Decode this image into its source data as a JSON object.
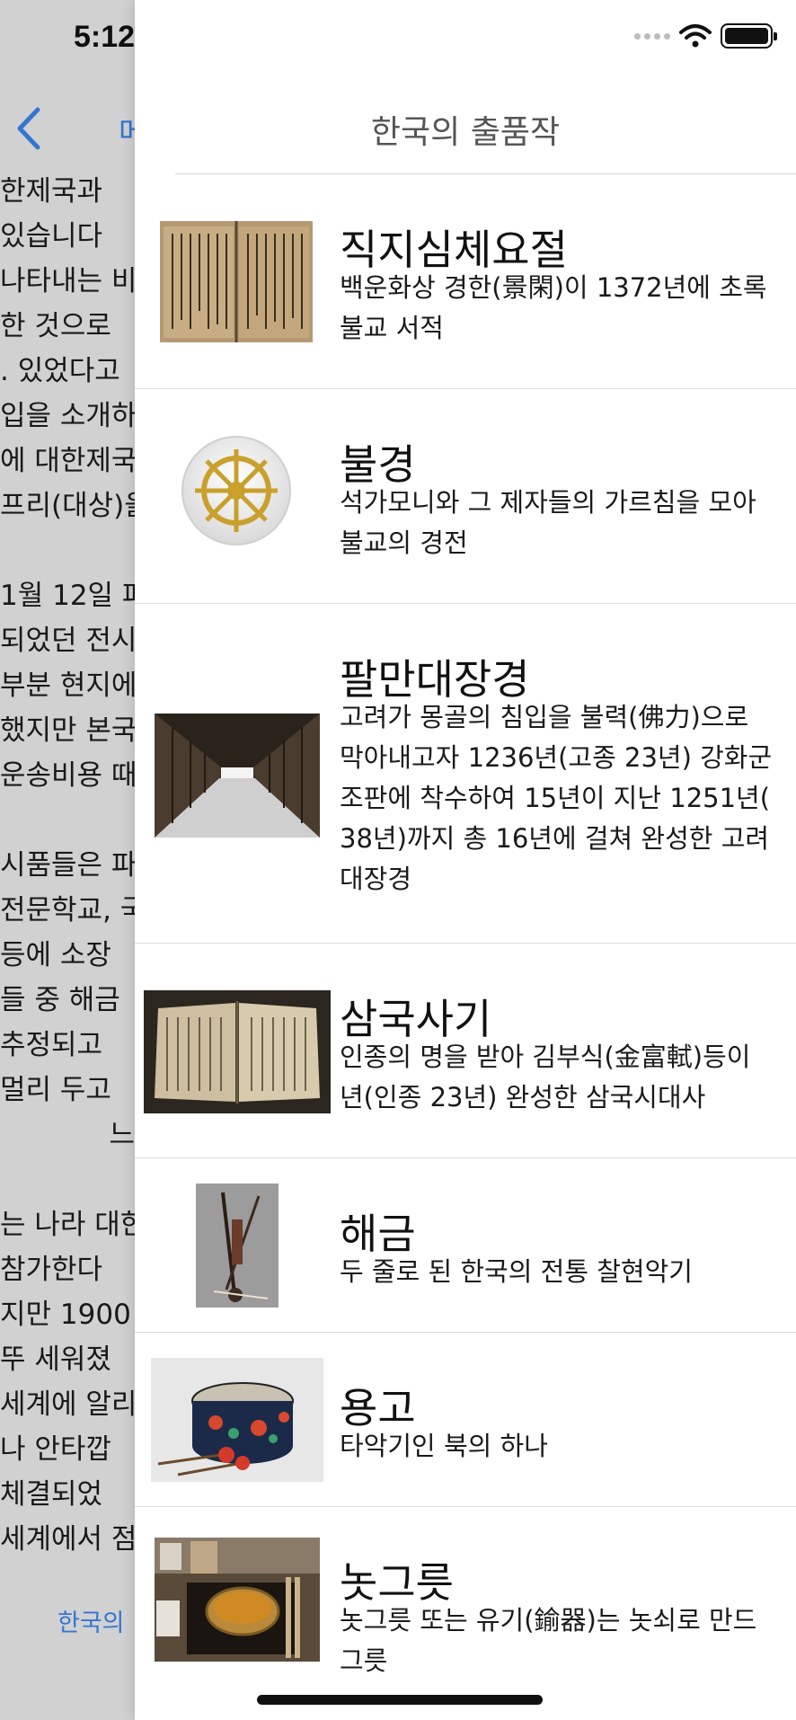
{
  "background_screen": {
    "time": "5:12",
    "back_label": "메인",
    "lines": [
      "한제국과",
      "있습니다",
      "나타내는 비",
      "한 것으로 ",
      ". 있었다고",
      "입을 소개하",
      "에 대한제국",
      "프리(대상)을",
      "",
      "1월 12일 파",
      "되었던 전시",
      "부분 현지에",
      "했지만 본국",
      "운송비용 때",
      "",
      "시품들은 파",
      "전문학교, 국",
      "등에 소장",
      "들 중 해금",
      "추정되고",
      "멀리 두고",
      "느",
      "",
      "는 나라 대한",
      "참가한다",
      "지만 1900",
      "뚜 세워졌",
      "세계에 알리",
      "나 안타깝",
      "체결되었",
      "세계에서 점"
    ],
    "link": "한국의"
  },
  "nav": {
    "title": "한국의 출품작"
  },
  "items": [
    {
      "title": "직지심체요절",
      "subtitle": "백운화상 경한(景閑)이 1372년에 초록\n불교 서적",
      "image": "book-page"
    },
    {
      "title": "불경",
      "subtitle": "석가모니와 그 제자들의 가르침을 모아\n불교의 경전",
      "image": "dharma-wheel"
    },
    {
      "title": "팔만대장경",
      "subtitle": "고려가 몽골의 침입을 불력(佛力)으로\n막아내고자 1236년(고종 23년) 강화군\n조판에 착수하여 15년이 지난 1251년(\n38년)까지 총 16년에 걸쳐 완성한 고려\n대장경",
      "image": "library-hall"
    },
    {
      "title": "삼국사기",
      "subtitle": "인종의 명을 받아 김부식(金富軾)등이\n년(인종 23년) 완성한 삼국시대사",
      "image": "open-book"
    },
    {
      "title": "해금",
      "subtitle": "두 줄로 된 한국의 전통 찰현악기",
      "image": "haegeum"
    },
    {
      "title": "용고",
      "subtitle": "타악기인 북의 하나",
      "image": "drum"
    },
    {
      "title": "놋그릇",
      "subtitle": "놋그릇 또는 유기(鍮器)는 놋쇠로 만드\n그릇",
      "image": "brass-bowl"
    }
  ]
}
